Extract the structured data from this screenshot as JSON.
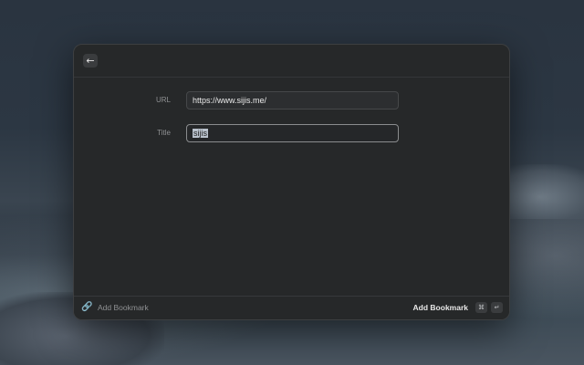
{
  "header": {
    "back_icon": "arrow-left-icon"
  },
  "form": {
    "url_label": "URL",
    "url_value": "https://www.sijis.me/",
    "title_label": "Title",
    "title_value": "sijis"
  },
  "footer": {
    "icon": "bookmark-link-icon",
    "title": "Add Bookmark",
    "action_label": "Add Bookmark",
    "shortcut": [
      "⌘",
      "↵"
    ]
  }
}
